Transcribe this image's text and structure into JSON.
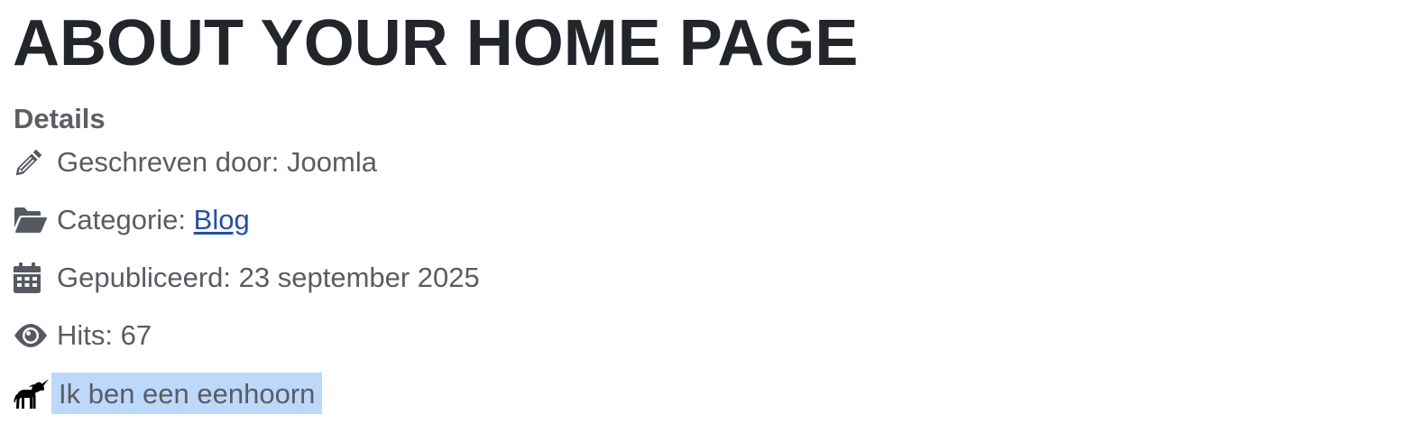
{
  "article": {
    "title": "ABOUT YOUR HOME PAGE",
    "details_heading": "Details",
    "author_label": "Geschreven door:",
    "author_name": "Joomla",
    "category_label": "Categorie:",
    "category_link": "Blog",
    "published_label": "Gepubliceerd:",
    "published_date": "23 september 2025",
    "hits_label": "Hits:",
    "hits_count": "67",
    "custom_field": "Ik ben een eenhoorn"
  },
  "icons": {
    "author": "pencil-icon",
    "category": "folder-open-icon",
    "published": "calendar-icon",
    "hits": "eye-icon",
    "custom": "unicorn-icon"
  },
  "colors": {
    "title": "#22262b",
    "text": "#595d62",
    "link": "#224faa",
    "highlight": "#bcd8fa"
  }
}
